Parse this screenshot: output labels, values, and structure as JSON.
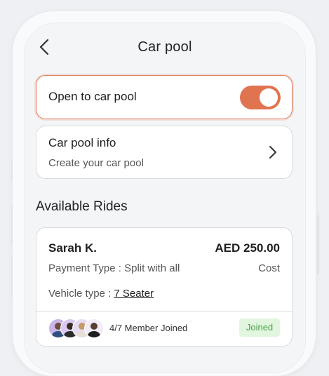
{
  "header": {
    "title": "Car pool",
    "back_icon": "chevron-left-icon"
  },
  "carpool_toggle": {
    "label": "Open to car pool",
    "enabled": true,
    "accent_color": "#e07450"
  },
  "carpool_info": {
    "title": "Car pool info",
    "subtitle": "Create your car pool",
    "icon": "chevron-right-icon"
  },
  "available_rides": {
    "section_title": "Available Rides",
    "rides": [
      {
        "driver": "Sarah K.",
        "price": "AED 250.00",
        "payment_type": "Payment Type : Split with all",
        "price_caption": "Cost",
        "vehicle_prefix": "Vehicle type : ",
        "vehicle_type": "7 Seater",
        "members": "4/7 Member Joined",
        "status": "Joined",
        "status_color": "#4aa24a"
      }
    ]
  }
}
